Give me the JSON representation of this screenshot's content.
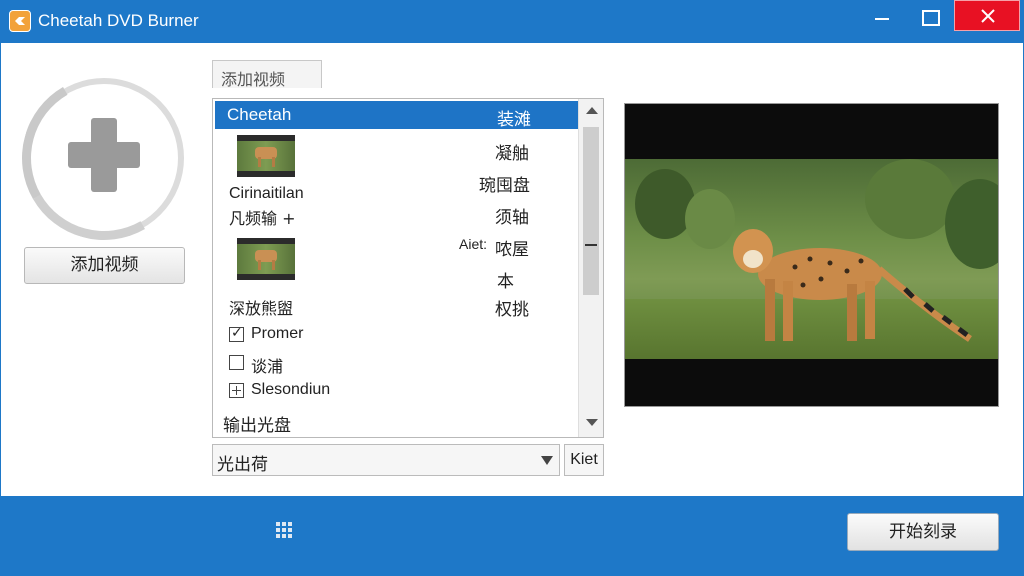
{
  "window": {
    "title": "Cheetah DVD Burner"
  },
  "left": {
    "add_button_label": "添加视频"
  },
  "tab": {
    "label": "添加视频"
  },
  "list": {
    "selected_row": {
      "name": "Cheetah",
      "value": "装滩"
    },
    "right_column": [
      "凝舳",
      "琬囤盘",
      "须轴",
      "哝屋",
      "本",
      "权挑"
    ],
    "right_prefix": "Aiet:",
    "item1_title": "Cirinaitilan",
    "item1_subtitle": "凡频输 +",
    "item2_title": "深放熊盥",
    "checkbox_items": [
      {
        "label": "Promer",
        "checked": true
      },
      {
        "label": "谈浦",
        "checked": false
      }
    ],
    "expand_item": "Slesondiun",
    "output_label": "输出光盘"
  },
  "dropdown": {
    "value": "光出荷",
    "side_button": "Kiet"
  },
  "footer": {
    "start_button": "开始刻录"
  },
  "colors": {
    "accent": "#1e78c8",
    "close": "#e81123",
    "selection": "#1e74c6"
  }
}
